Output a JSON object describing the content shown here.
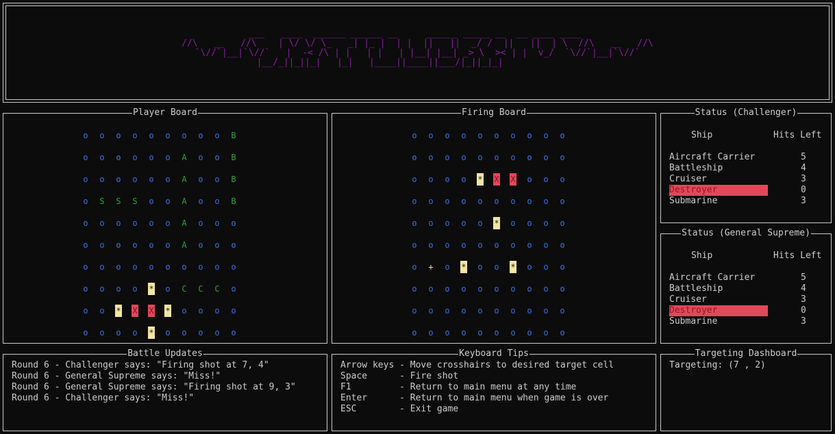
{
  "banner": {
    "art_lines": [
      "                                  ___   ____  ______ ______ __     ______ _____ __  __ ____ ____                                   ",
      "  //\\   __   //\\    | \\/ \\/ \\_   _| |_ |  | |  ||   ||  _/ /  ||   ||  | \\  //\\   __   //\\  ",
      " `\\//`|__|`\\//`   |  -< /\\ | |   | |   | |__| |__| _> \\  >< | |  v_/  `\\//`|__|`\\//` ",
      "                    |__/_||_||_|   |_|   |____||____||___/|_||_|_|                                  "
    ]
  },
  "player_board": {
    "title": "Player Board",
    "rows": [
      [
        "o",
        "o",
        "o",
        "o",
        "o",
        "o",
        "o",
        "o",
        "o",
        "B"
      ],
      [
        "o",
        "o",
        "o",
        "o",
        "o",
        "o",
        "A",
        "o",
        "o",
        "B"
      ],
      [
        "o",
        "o",
        "o",
        "o",
        "o",
        "o",
        "A",
        "o",
        "o",
        "B"
      ],
      [
        "o",
        "S",
        "S",
        "S",
        "o",
        "o",
        "A",
        "o",
        "o",
        "B"
      ],
      [
        "o",
        "o",
        "o",
        "o",
        "o",
        "o",
        "A",
        "o",
        "o",
        "o"
      ],
      [
        "o",
        "o",
        "o",
        "o",
        "o",
        "o",
        "A",
        "o",
        "o",
        "o"
      ],
      [
        "o",
        "o",
        "o",
        "o",
        "o",
        "o",
        "o",
        "o",
        "o",
        "o"
      ],
      [
        "o",
        "o",
        "o",
        "o",
        "*",
        "o",
        "C",
        "C",
        "C",
        "o"
      ],
      [
        "o",
        "o",
        "*",
        "X",
        "X",
        "*",
        "o",
        "o",
        "o",
        "o"
      ],
      [
        "o",
        "o",
        "o",
        "o",
        "*",
        "o",
        "o",
        "o",
        "o",
        "o"
      ]
    ]
  },
  "firing_board": {
    "title": "Firing Board",
    "rows": [
      [
        "o",
        "o",
        "o",
        "o",
        "o",
        "o",
        "o",
        "o",
        "o",
        "o"
      ],
      [
        "o",
        "o",
        "o",
        "o",
        "o",
        "o",
        "o",
        "o",
        "o",
        "o"
      ],
      [
        "o",
        "o",
        "o",
        "o",
        "*",
        "X",
        "X",
        "o",
        "o",
        "o"
      ],
      [
        "o",
        "o",
        "o",
        "o",
        "o",
        "o",
        "o",
        "o",
        "o",
        "o"
      ],
      [
        "o",
        "o",
        "o",
        "o",
        "o",
        "*",
        "o",
        "o",
        "o",
        "o"
      ],
      [
        "o",
        "o",
        "o",
        "o",
        "o",
        "o",
        "o",
        "o",
        "o",
        "o"
      ],
      [
        "o",
        "+",
        "o",
        "*",
        "o",
        "o",
        "*",
        "o",
        "o",
        "o"
      ],
      [
        "o",
        "o",
        "o",
        "o",
        "o",
        "o",
        "o",
        "o",
        "o",
        "o"
      ],
      [
        "o",
        "o",
        "o",
        "o",
        "o",
        "o",
        "o",
        "o",
        "o",
        "o"
      ],
      [
        "o",
        "o",
        "o",
        "o",
        "o",
        "o",
        "o",
        "o",
        "o",
        "o"
      ]
    ]
  },
  "status_challenger": {
    "title": "Status (Challenger)",
    "col_ship": "Ship",
    "col_hits": "Hits Left",
    "ships": [
      {
        "name": "Aircraft Carrier",
        "hits": "5",
        "sunk": false
      },
      {
        "name": "Battleship",
        "hits": "4",
        "sunk": false
      },
      {
        "name": "Cruiser",
        "hits": "3",
        "sunk": false
      },
      {
        "name": "Destroyer",
        "hits": "0",
        "sunk": true
      },
      {
        "name": "Submarine",
        "hits": "3",
        "sunk": false
      }
    ]
  },
  "status_general": {
    "title": "Status (General Supreme)",
    "col_ship": "Ship",
    "col_hits": "Hits Left",
    "ships": [
      {
        "name": "Aircraft Carrier",
        "hits": "5",
        "sunk": false
      },
      {
        "name": "Battleship",
        "hits": "4",
        "sunk": false
      },
      {
        "name": "Cruiser",
        "hits": "3",
        "sunk": false
      },
      {
        "name": "Destroyer",
        "hits": "0",
        "sunk": true
      },
      {
        "name": "Submarine",
        "hits": "3",
        "sunk": false
      }
    ]
  },
  "battle_updates": {
    "title": "Battle Updates",
    "lines": [
      "Round 6 - Challenger says: \"Firing shot at 7, 4\"",
      "Round 6 - General Supreme says: \"Miss!\"",
      "Round 6 - General Supreme says: \"Firing shot at 9, 3\"",
      "Round 6 - Challenger says: \"Miss!\""
    ]
  },
  "keyboard_tips": {
    "title": "Keyboard Tips",
    "lines": [
      "Arrow keys - Move crosshairs to desired target cell",
      "Space      - Fire shot",
      "F1         - Return to main menu at any time",
      "Enter      - Return to main menu when game is over",
      "ESC        - Exit game"
    ]
  },
  "targeting": {
    "title": "Targeting Dashboard",
    "text": "Targeting: (7 , 2)"
  },
  "colors": {
    "water": "#3d6fe0",
    "ship": "#2fa33a",
    "hit": "#e3485a",
    "miss": "#f2e6a3",
    "banner": "#8a1fa3"
  }
}
